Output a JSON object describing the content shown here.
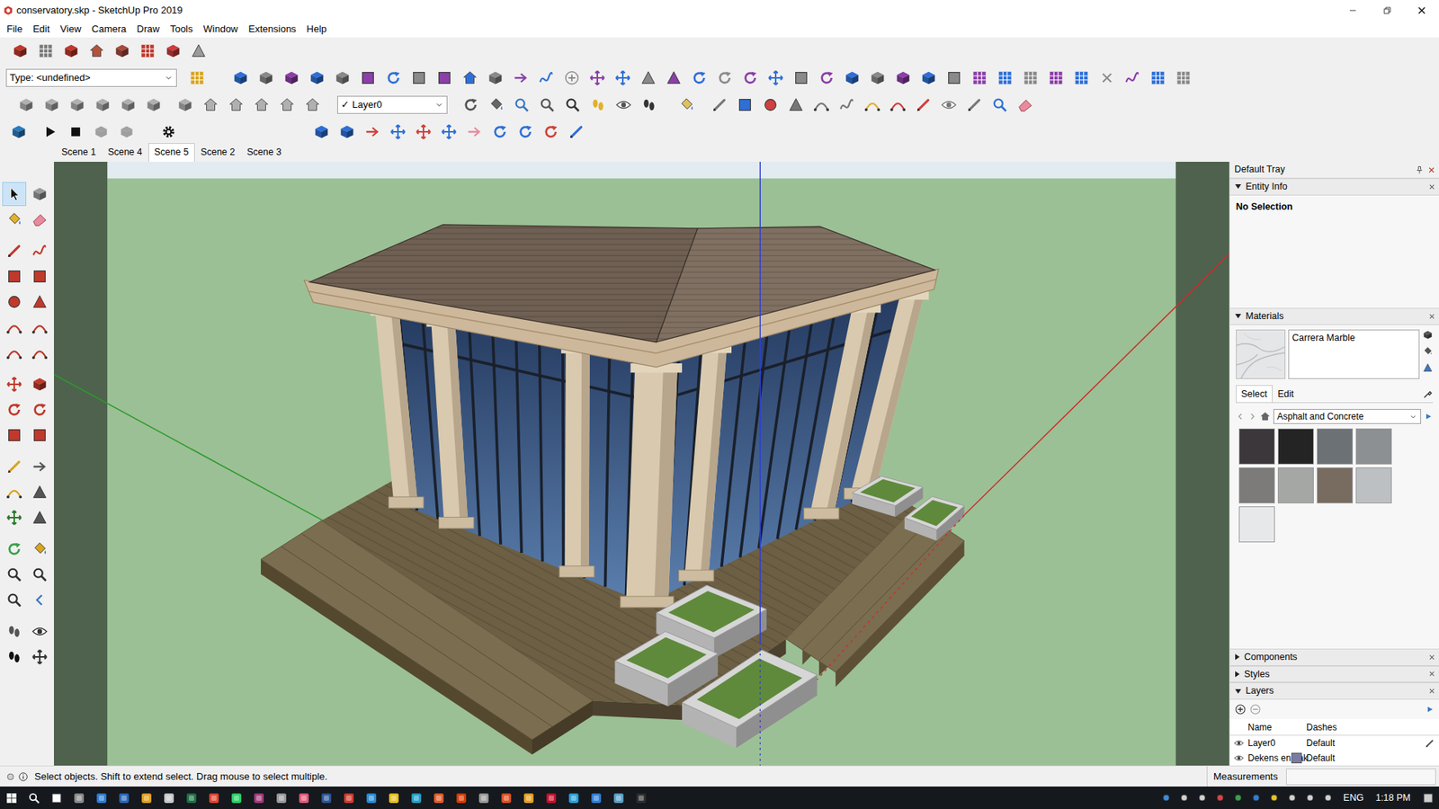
{
  "window": {
    "title": "conservatory.skp - SketchUp Pro 2019"
  },
  "menu": [
    "File",
    "Edit",
    "View",
    "Camera",
    "Draw",
    "Tools",
    "Window",
    "Extensions",
    "Help"
  ],
  "toolbar": {
    "type_dropdown": "Type: <undefined>",
    "layer_dropdown": {
      "check": "✓",
      "label": "Layer0"
    },
    "animation_tools": [
      {
        "disabled": false
      },
      {
        "disabled": false
      },
      {
        "disabled": true
      },
      {
        "disabled": true
      },
      {
        "disabled": false
      }
    ]
  },
  "scenes": [
    {
      "label": "Scene 1",
      "selected": false
    },
    {
      "label": "Scene 4",
      "selected": false
    },
    {
      "label": "Scene 5",
      "selected": true
    },
    {
      "label": "Scene 2",
      "selected": false
    },
    {
      "label": "Scene 3",
      "selected": false
    }
  ],
  "left_tools": [
    {
      "selected": true
    },
    {
      "selected": false
    },
    {
      "selected": false
    },
    {
      "selected": false
    },
    {
      "selected": false
    },
    {
      "selected": false
    },
    {
      "selected": false
    },
    {
      "selected": false
    },
    {
      "selected": false
    },
    {
      "selected": false
    },
    {
      "selected": false
    },
    {
      "selected": false
    },
    {
      "selected": false
    },
    {
      "selected": false
    },
    {
      "selected": false
    },
    {
      "selected": false
    },
    {
      "selected": false
    },
    {
      "selected": false
    },
    {
      "selected": false
    },
    {
      "selected": false
    },
    {
      "selected": false
    },
    {
      "selected": false
    },
    {
      "selected": false
    },
    {
      "selected": false
    },
    {
      "selected": false
    },
    {
      "selected": false
    },
    {
      "selected": false
    },
    {
      "selected": false
    },
    {
      "selected": false
    },
    {
      "selected": false
    },
    {
      "selected": false
    },
    {
      "selected": false
    },
    {
      "selected": false
    },
    {
      "selected": false
    },
    {
      "selected": false
    },
    {
      "selected": false
    }
  ],
  "tray": {
    "title": "Default Tray",
    "entity_info": {
      "title": "Entity Info",
      "expanded": true,
      "selection": "No Selection"
    },
    "materials": {
      "title": "Materials",
      "expanded": true,
      "current": "Carrera Marble",
      "tabs": [
        {
          "label": "Select",
          "selected": true
        },
        {
          "label": "Edit",
          "selected": false
        }
      ],
      "collection": "Asphalt and Concrete",
      "swatches": [
        {
          "color": "#3b373b"
        },
        {
          "color": "#242424"
        },
        {
          "color": "#6c7176"
        },
        {
          "color": "#8d9092"
        },
        {
          "color": "#7d7a7a"
        },
        {
          "color": "#a5a7a4"
        },
        {
          "color": "#786c60"
        },
        {
          "color": "#bcc0c2"
        },
        {
          "color": "#e7e8ea"
        }
      ]
    },
    "collapsed_panels": [
      {
        "title": "Components",
        "expanded": false
      },
      {
        "title": "Styles",
        "expanded": false
      }
    ],
    "layers": {
      "title": "Layers",
      "expanded": true,
      "columns": [
        "Name",
        "Dashes"
      ],
      "rows": [
        {
          "name": "Layer0",
          "dashes": "Default",
          "visible": true,
          "current": true
        },
        {
          "name": "Dekens en Lak",
          "dashes": "Default",
          "visible": true,
          "current": false,
          "color": "#7b7ba0"
        }
      ]
    }
  },
  "status_bar": {
    "hint": "Select objects. Shift to extend select. Drag mouse to select multiple.",
    "measurements": "Measurements"
  },
  "taskbar": {
    "language": "ENG",
    "time": "1:18 PM"
  }
}
